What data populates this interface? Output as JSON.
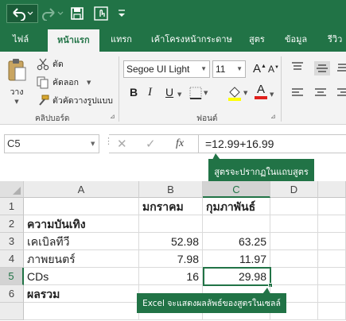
{
  "qat": {
    "icons": [
      "undo-icon",
      "redo-icon",
      "save-icon",
      "touch-mode-icon",
      "more-icon"
    ]
  },
  "tabs": [
    "ไฟล์",
    "หน้าแรก",
    "แทรก",
    "เค้าโครงหน้ากระดาษ",
    "สูตร",
    "ข้อมูล",
    "รีวิว"
  ],
  "clipboard": {
    "paste": "วาง",
    "cut": "ตัด",
    "copy": "คัดลอก",
    "format_painter": "ตัวคัดวางรูปแบบ",
    "label": "คลิปบอร์ด"
  },
  "font": {
    "name": "Segoe UI Light",
    "size": "11",
    "label": "ฟอนต์",
    "bold": "B",
    "italic": "I",
    "underline": "U"
  },
  "formula_bar": {
    "name_box": "C5",
    "fx": "fx",
    "formula": "=12.99+16.99"
  },
  "callouts": {
    "formula": "สูตรจะปรากฏในแถบสูตร",
    "result": "Excel จะแสดงผลลัพธ์ของสูตรในเซลล์"
  },
  "columns": [
    "A",
    "B",
    "C",
    "D"
  ],
  "rows": [
    "1",
    "2",
    "3",
    "4",
    "5",
    "6"
  ],
  "cells": {
    "b1": "มกราคม",
    "c1": "กุมภาพันธ์",
    "a2": "ความบันเทิง",
    "a3": "เคเบิลทีวี",
    "b3": "52.98",
    "c3": "63.25",
    "a4": "ภาพยนตร์",
    "b4": "7.98",
    "c4": "11.97",
    "a5": "CDs",
    "b5": "16",
    "c5": "29.98",
    "a6": "ผลรวม"
  },
  "colors": {
    "excel_green": "#217346"
  }
}
